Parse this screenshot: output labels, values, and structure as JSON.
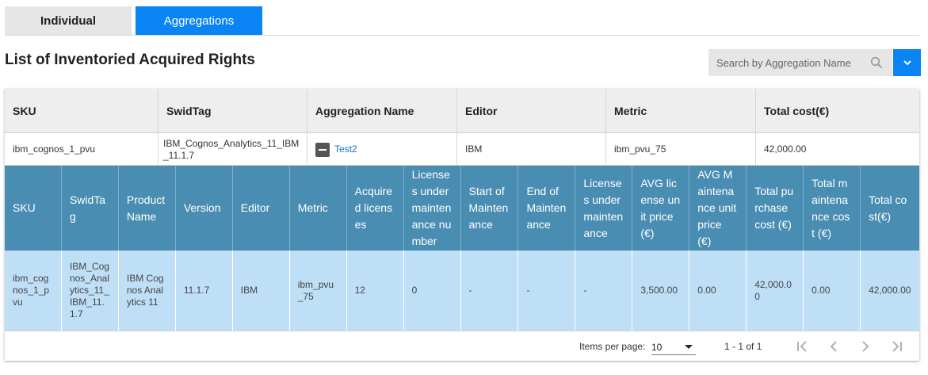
{
  "tabs": [
    {
      "label": "Individual",
      "active": false
    },
    {
      "label": "Aggregations",
      "active": true
    }
  ],
  "page_title": "List of Inventoried Acquired Rights",
  "search": {
    "placeholder": "Search by Aggregation Name",
    "value": ""
  },
  "colors": {
    "accent": "#0a84f5",
    "inner_header": "#4a8db3",
    "inner_row": "#bfdff7",
    "link": "#1a73c8"
  },
  "outer_table": {
    "headers": [
      "SKU",
      "SwidTag",
      "Aggregation Name",
      "Editor",
      "Metric",
      "Total cost(€)"
    ],
    "row": {
      "sku": "ibm_cognos_1_pvu",
      "swidtag": "IBM_Cognos_Analytics_11_IBM_11.1.7",
      "aggregation_name": "Test2",
      "editor": "IBM",
      "metric": "ibm_pvu_75",
      "total_cost": "42,000.00"
    }
  },
  "inner_table": {
    "headers": [
      "SKU",
      "SwidTag",
      "Product Name",
      "Version",
      "Editor",
      "Metric",
      "Acquired licenses",
      "Licenses under maintenance number",
      "Start of Maintenance",
      "End of Maintenance",
      "Licenses under maintenance",
      "AVG license unit price (€)",
      "AVG Maintenance unit price (€)",
      "Total purchase cost (€)",
      "Total maintenance cost (€)",
      "Total cost(€)"
    ],
    "row": [
      "ibm_cognos_1_pvu",
      "IBM_Cognos_Analytics_11_IBM_11.1.7",
      "IBM Cognos Analytics 11",
      "11.1.7",
      "IBM",
      "ibm_pvu_75",
      "12",
      "0",
      "-",
      "-",
      "-",
      "3,500.00",
      "0.00",
      "42,000.00",
      "0.00",
      "42,000.00"
    ]
  },
  "paginator": {
    "items_per_page_label": "Items per page:",
    "items_per_page": "10",
    "range": "1 - 1 of 1"
  },
  "icons": [
    "search-icon",
    "chevron-down-icon",
    "collapse-icon",
    "first-page-icon",
    "previous-page-icon",
    "next-page-icon",
    "last-page-icon"
  ]
}
